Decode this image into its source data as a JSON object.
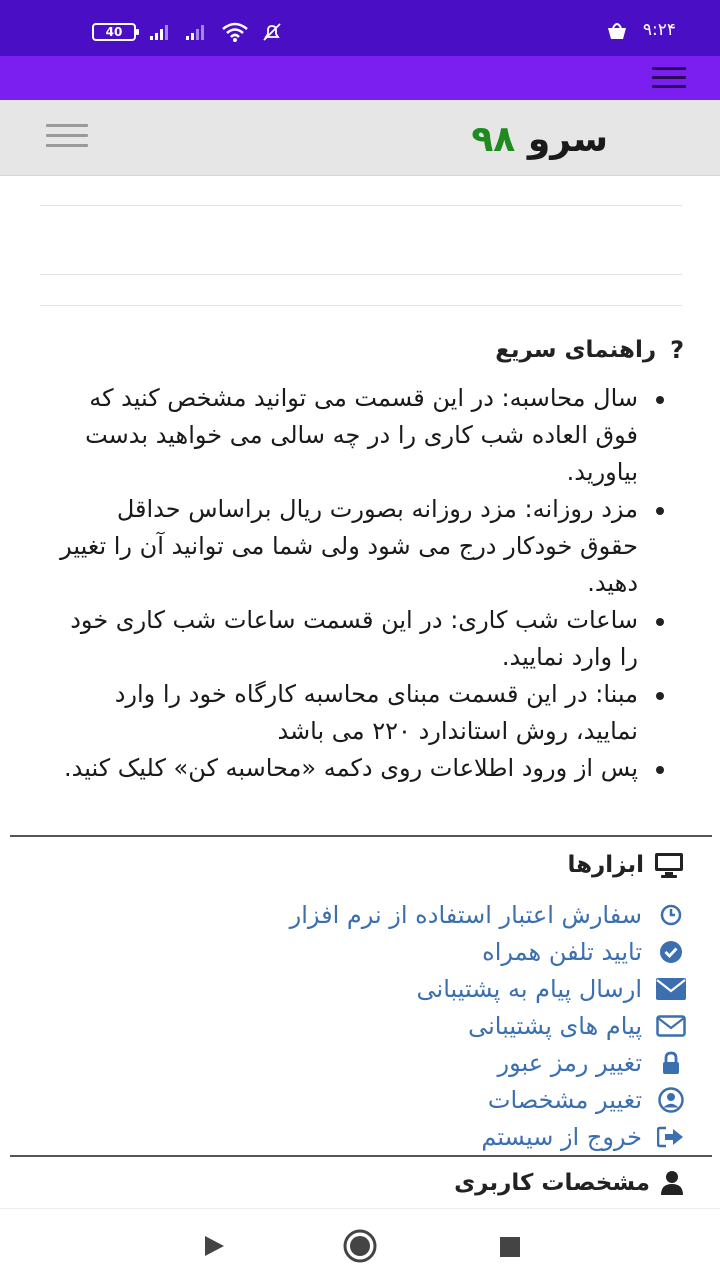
{
  "status_bar": {
    "time": "۹:۲۴",
    "battery": "40"
  },
  "header": {
    "logo_word": "سرو",
    "logo_number": "۹۸"
  },
  "quick_guide": {
    "title": "راهنمای سریع",
    "items": [
      "سال محاسبه: در این قسمت می توانید مشخص کنید که فوق العاده شب کاری را در چه سالی می خواهید بدست بیاورید.",
      "مزد روزانه: مزد روزانه بصورت ریال براساس حداقل حقوق خودکار درج می شود ولی شما می توانید آن را تغییر دهید.",
      "ساعات شب کاری: در این قسمت ساعات شب کاری خود را وارد نمایید.",
      "مبنا: در این قسمت مبنای محاسبه کارگاه خود را وارد نمایید، روش استاندارد ۲۲۰ می باشد",
      "پس از ورود اطلاعات روی دکمه «محاسبه کن» کلیک کنید."
    ]
  },
  "tools": {
    "title": "ابزارها",
    "links": [
      {
        "label": "سفارش اعتبار استفاده از نرم افزار",
        "icon": "clock-icon"
      },
      {
        "label": "تایید تلفن همراه",
        "icon": "check-circle-icon"
      },
      {
        "label": "ارسال پیام به پشتیبانی",
        "icon": "envelope-solid-icon"
      },
      {
        "label": "پیام های پشتیبانی",
        "icon": "envelope-outline-icon"
      },
      {
        "label": "تغییر رمز عبور",
        "icon": "lock-icon"
      },
      {
        "label": "تغییر مشخصات",
        "icon": "user-circle-icon"
      },
      {
        "label": "خروج از سیستم",
        "icon": "sign-out-icon"
      }
    ]
  },
  "user_info": {
    "title": "مشخصات کاربری"
  },
  "colors": {
    "status_bar": "#4a0fc4",
    "app_bar": "#7a1ff0",
    "link": "#3b6fb0",
    "logo_number": "#1f8a1f"
  }
}
